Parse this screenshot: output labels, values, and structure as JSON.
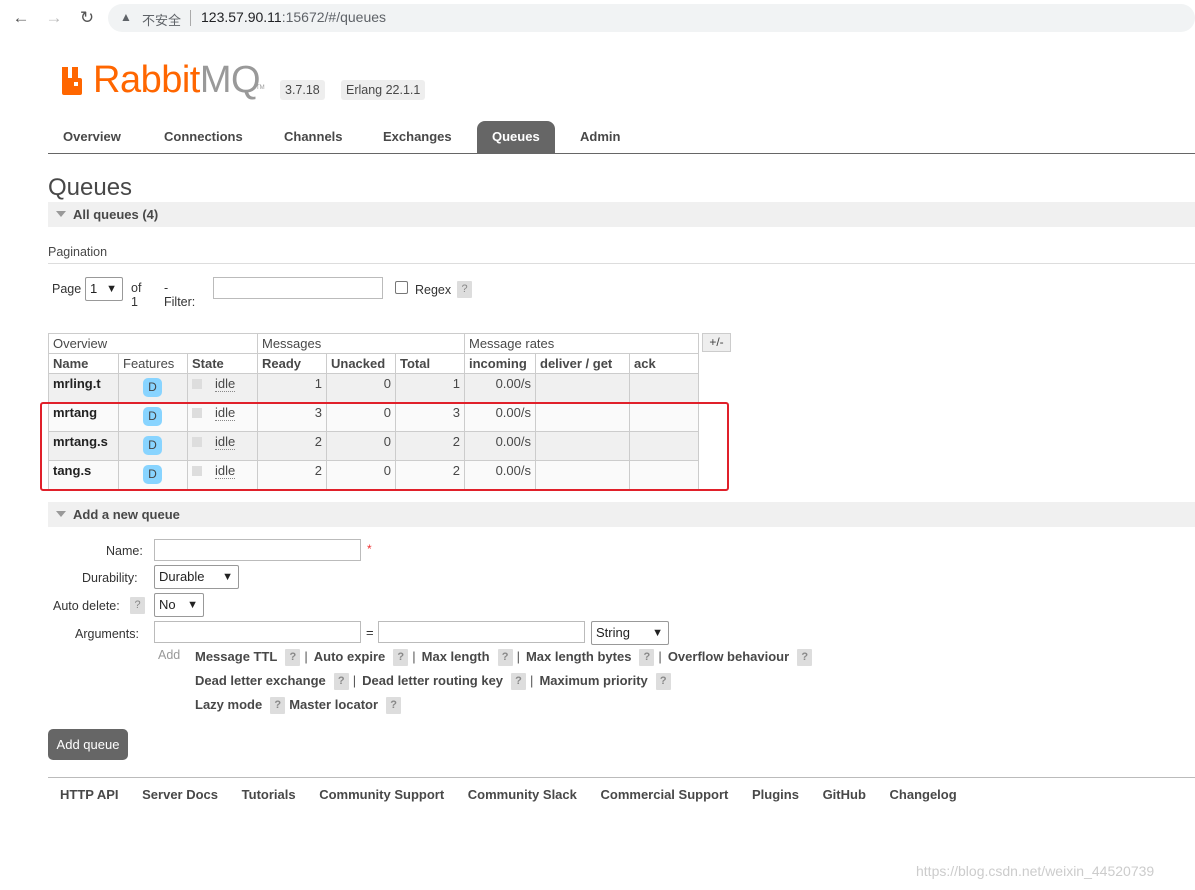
{
  "browser": {
    "insecure_label": "不安全",
    "url_host": "123.57.90.11",
    "url_path": ":15672/#/queues"
  },
  "header": {
    "logo_rabbit": "Rabbit",
    "logo_mq": "MQ",
    "logo_tm": "TM",
    "version": "3.7.18",
    "erlang": "Erlang 22.1.1"
  },
  "tabs": [
    "Overview",
    "Connections",
    "Channels",
    "Exchanges",
    "Queues",
    "Admin"
  ],
  "page_title": "Queues",
  "all_queues_label": "All queues (4)",
  "pagination": {
    "title": "Pagination",
    "page_label": "Page",
    "page_value": "1",
    "of_label": "of 1",
    "filter_label": "- Filter:",
    "regex_label": "Regex",
    "help": "?"
  },
  "table": {
    "groups": [
      "Overview",
      "Messages",
      "Message rates"
    ],
    "columns": [
      "Name",
      "Features",
      "State",
      "Ready",
      "Unacked",
      "Total",
      "incoming",
      "deliver / get",
      "ack"
    ],
    "plusminus": "+/-",
    "rows": [
      {
        "name": "mrling.t",
        "feature": "D",
        "state": "idle",
        "ready": "1",
        "unacked": "0",
        "total": "1",
        "incoming": "0.00/s"
      },
      {
        "name": "mrtang",
        "feature": "D",
        "state": "idle",
        "ready": "3",
        "unacked": "0",
        "total": "3",
        "incoming": "0.00/s"
      },
      {
        "name": "mrtang.s",
        "feature": "D",
        "state": "idle",
        "ready": "2",
        "unacked": "0",
        "total": "2",
        "incoming": "0.00/s"
      },
      {
        "name": "tang.s",
        "feature": "D",
        "state": "idle",
        "ready": "2",
        "unacked": "0",
        "total": "2",
        "incoming": "0.00/s"
      }
    ]
  },
  "add_queue": {
    "section_label": "Add a new queue",
    "name_label": "Name:",
    "required": "*",
    "durability_label": "Durability:",
    "durability_value": "Durable",
    "auto_delete_label": "Auto delete:",
    "auto_delete_value": "No",
    "arguments_label": "Arguments:",
    "equals": "=",
    "arg_type": "String",
    "add_link": "Add",
    "shortcuts_row1": [
      "Message TTL",
      "Auto expire",
      "Max length",
      "Max length bytes",
      "Overflow behaviour"
    ],
    "shortcuts_row2": [
      "Dead letter exchange",
      "Dead letter routing key",
      "Maximum priority"
    ],
    "shortcuts_row3": [
      "Lazy mode",
      "Master locator"
    ],
    "pipe": "|",
    "button": "Add queue"
  },
  "footer": [
    "HTTP API",
    "Server Docs",
    "Tutorials",
    "Community Support",
    "Community Slack",
    "Commercial Support",
    "Plugins",
    "GitHub",
    "Changelog"
  ],
  "watermark": "https://blog.csdn.net/weixin_44520739",
  "colors": {
    "brand_orange": "#ff6600",
    "active_tab": "#666666",
    "feature_badge": "#88d4ff",
    "highlight_box": "#e0202a"
  }
}
